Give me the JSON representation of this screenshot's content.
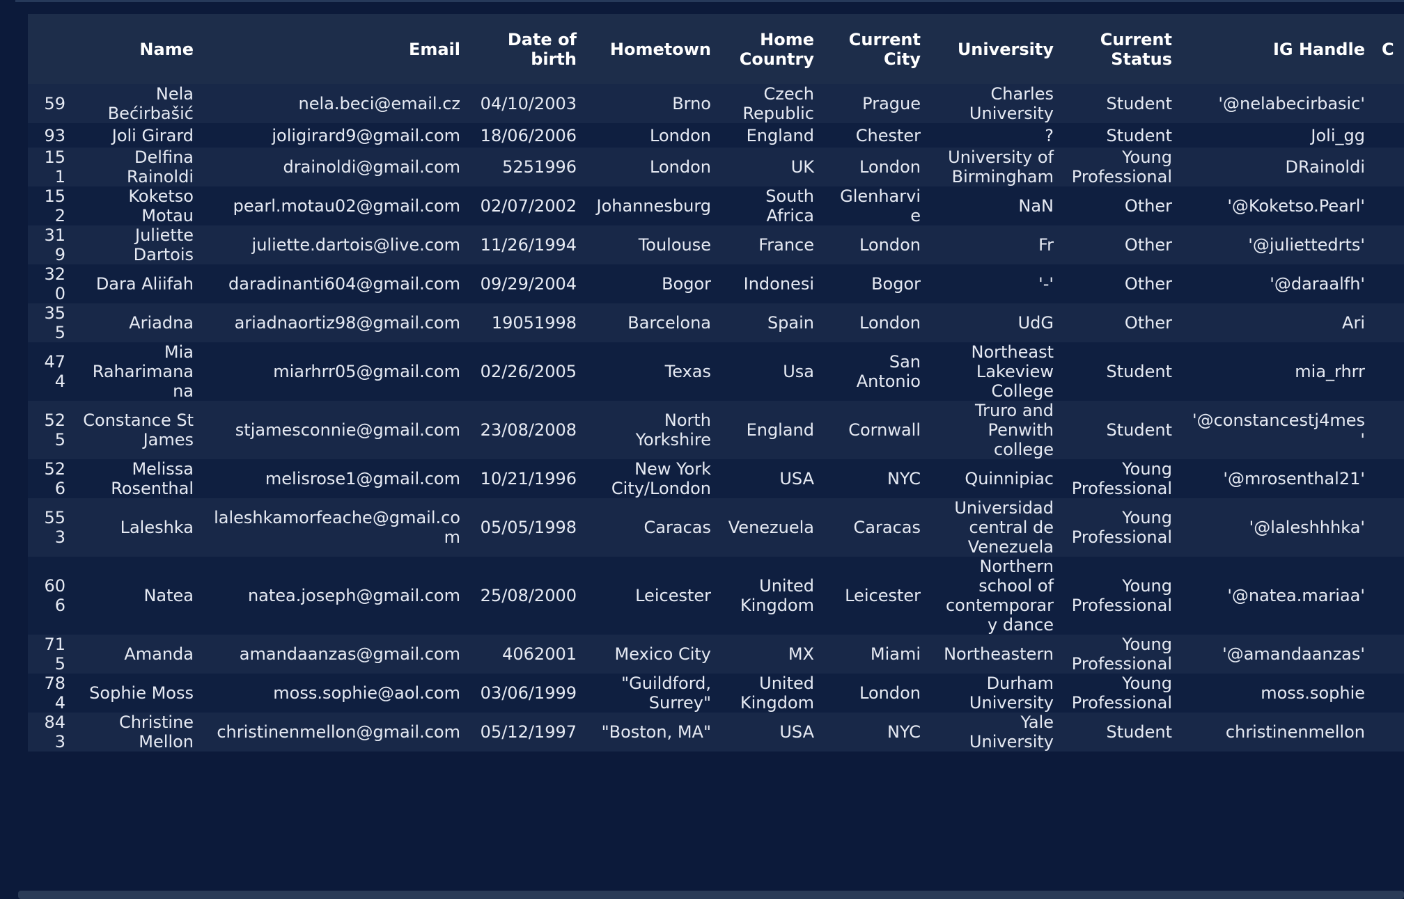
{
  "table": {
    "headers": {
      "index": "",
      "name": "Name",
      "email": "Email",
      "dob": "Date of birth",
      "hometown": "Hometown",
      "home_country": "Home Country",
      "current_city": "Current City",
      "university": "University",
      "current_status": "Current Status",
      "ig_handle": "IG Handle",
      "extra": "C"
    },
    "rows": [
      {
        "idx": "59",
        "name": "Nela Bećirbašić",
        "email": "nela.beci@email.cz",
        "dob": "04/10/2003",
        "hometown": "Brno",
        "country": "Czech Republic",
        "city": "Prague",
        "university": "Charles University",
        "status": "Student",
        "ig": "'@nelabecirbasic'"
      },
      {
        "idx": "93",
        "name": "Joli Girard",
        "email": "joligirard9@gmail.com",
        "dob": "18/06/2006",
        "hometown": "London",
        "country": "England",
        "city": "Chester",
        "university": "?",
        "status": "Student",
        "ig": "Joli_gg"
      },
      {
        "idx": "151",
        "name": "Delfina Rainoldi",
        "email": "drainoldi@gmail.com",
        "dob": "5251996",
        "hometown": "London",
        "country": "UK",
        "city": "London",
        "university": "University of Birmingham",
        "status": "Young Professional",
        "ig": "DRainoldi"
      },
      {
        "idx": "152",
        "name": "Koketso Motau",
        "email": "pearl.motau02@gmail.com",
        "dob": "02/07/2002",
        "hometown": "Johannesburg",
        "country": "South Africa",
        "city": "Glenharvie",
        "university": "NaN",
        "status": "Other",
        "ig": "'@Koketso.Pearl'"
      },
      {
        "idx": "319",
        "name": "Juliette Dartois",
        "email": "juliette.dartois@live.com",
        "dob": "11/26/1994",
        "hometown": "Toulouse",
        "country": "France",
        "city": "London",
        "university": "Fr",
        "status": "Other",
        "ig": "'@juliettedrts'"
      },
      {
        "idx": "320",
        "name": "Dara Aliifah",
        "email": "daradinanti604@gmail.com",
        "dob": "09/29/2004",
        "hometown": "Bogor",
        "country": "Indonesi",
        "city": "Bogor",
        "university": "'-'",
        "status": "Other",
        "ig": "'@daraalfh'"
      },
      {
        "idx": "355",
        "name": "Ariadna",
        "email": "ariadnaortiz98@gmail.com",
        "dob": "19051998",
        "hometown": "Barcelona",
        "country": "Spain",
        "city": "London",
        "university": "UdG",
        "status": "Other",
        "ig": "Ari"
      },
      {
        "idx": "474",
        "name": "Mia Raharimanana",
        "email": "miarhrr05@gmail.com",
        "dob": "02/26/2005",
        "hometown": "Texas",
        "country": "Usa",
        "city": "San Antonio",
        "university": "Northeast Lakeview College",
        "status": "Student",
        "ig": "mia_rhrr"
      },
      {
        "idx": "525",
        "name": "Constance St James",
        "email": "stjamesconnie@gmail.com",
        "dob": "23/08/2008",
        "hometown": "North Yorkshire",
        "country": "England",
        "city": "Cornwall",
        "university": "Truro and Penwith college",
        "status": "Student",
        "ig": "'@constancestj4mes'"
      },
      {
        "idx": "526",
        "name": "Melissa Rosenthal",
        "email": "melisrose1@gmail.com",
        "dob": "10/21/1996",
        "hometown": "New York City/London",
        "country": "USA",
        "city": "NYC",
        "university": "Quinnipiac",
        "status": "Young Professional",
        "ig": "'@mrosenthal21'"
      },
      {
        "idx": "553",
        "name": "Laleshka",
        "email": "laleshkamorfeache@gmail.com",
        "dob": "05/05/1998",
        "hometown": "Caracas",
        "country": "Venezuela",
        "city": "Caracas",
        "university": "Universidad central de Venezuela",
        "status": "Young Professional",
        "ig": "'@laleshhhka'"
      },
      {
        "idx": "606",
        "name": "Natea",
        "email": "natea.joseph@gmail.com",
        "dob": "25/08/2000",
        "hometown": "Leicester",
        "country": "United Kingdom",
        "city": "Leicester",
        "university": "Northern school of contemporary dance",
        "status": "Young Professional",
        "ig": "'@natea.mariaa'"
      },
      {
        "idx": "715",
        "name": "Amanda",
        "email": "amandaanzas@gmail.com",
        "dob": "4062001",
        "hometown": "Mexico City",
        "country": "MX",
        "city": "Miami",
        "university": "Northeastern",
        "status": "Young Professional",
        "ig": "'@amandaanzas'"
      },
      {
        "idx": "784",
        "name": "Sophie Moss",
        "email": "moss.sophie@aol.com",
        "dob": "03/06/1999",
        "hometown": "\"Guildford, Surrey\"",
        "country": "United Kingdom",
        "city": "London",
        "university": "Durham University",
        "status": "Young Professional",
        "ig": "moss.sophie"
      },
      {
        "idx": "843",
        "name": "Christine Mellon",
        "email": "christinenmellon@gmail.com",
        "dob": "05/12/1997",
        "hometown": "\"Boston, MA\"",
        "country": "USA",
        "city": "NYC",
        "university": "Yale University",
        "status": "Student",
        "ig": "christinenmellon"
      }
    ]
  }
}
